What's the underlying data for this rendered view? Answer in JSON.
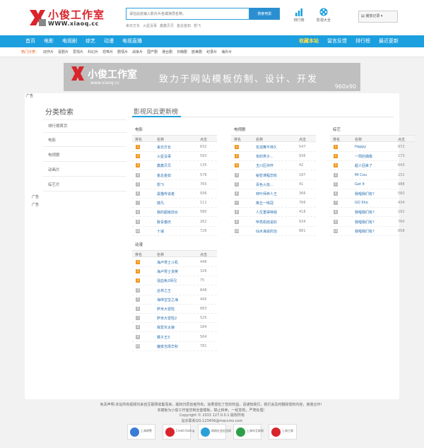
{
  "brand": {
    "name": "小俊工作室",
    "url": "WWW.xiaoq.cc",
    "accent": "#d9242c",
    "primary": "#1c9fde"
  },
  "search": {
    "placeholder": "请在此处输入影片片名或演员名称。",
    "button": "搜索电影",
    "hotwords": [
      "来日方长",
      "火星没事",
      "鑫鑫贝贝",
      "金总金如",
      "想飞"
    ]
  },
  "tools": [
    {
      "label": "排行榜",
      "icon": "bar-chart-icon"
    },
    {
      "label": "影视大全",
      "icon": "film-reel-icon"
    }
  ],
  "history": {
    "label": "播放记录"
  },
  "nav": {
    "left": [
      "首页",
      "电影",
      "电视剧",
      "综艺",
      "动漫",
      "电视直播"
    ],
    "right": [
      "收藏本站",
      "留言反馈",
      "排行榜",
      "最近更新"
    ]
  },
  "hot": {
    "label": "热门分类：",
    "items": [
      "动作片",
      "喜剧片",
      "爱情片",
      "科幻片",
      "恐怖片",
      "剧情片",
      "战争片",
      "国产剧",
      "港台剧",
      "日韩剧",
      "欧美剧",
      "纪录片",
      "海外片"
    ]
  },
  "banner": {
    "logo": "小俊工作室",
    "url": "www.xiaoq.cc",
    "slogan": "致力于网站模板仿制、设计、开发",
    "size": "960x90"
  },
  "ad_label": "广告",
  "sidebar": {
    "title": "分类检索",
    "items": [
      "排行榜首页",
      "电影",
      "电视剧",
      "动画片",
      "综艺片"
    ],
    "ads": [
      "广告",
      "广告"
    ]
  },
  "content": {
    "title": "影视风云更新榜",
    "col_rank": "排名",
    "col_name": "名称",
    "col_hits": "点击"
  },
  "tables": [
    {
      "name": "电影",
      "rows": [
        [
          "来日方长",
          "832"
        ],
        [
          "火星没事",
          "593"
        ],
        [
          "鑫鑫贝贝",
          "135"
        ],
        [
          "金总金如",
          "578"
        ],
        [
          "想飞",
          "765"
        ],
        [
          "黑猫传说者",
          "936"
        ],
        [
          "嫦凡",
          "111"
        ],
        [
          "我的超级前女",
          "580"
        ],
        [
          "致青春庆",
          "262"
        ],
        [
          "十诫",
          "726"
        ]
      ]
    },
    {
      "name": "电视剧",
      "rows": [
        [
          "花戎舞不停久",
          "547"
        ],
        [
          "攻的男子…",
          "936"
        ],
        [
          "玉川区侦杆",
          "42"
        ],
        [
          "秘密课程恋收",
          "187"
        ],
        [
          "青色火焰…",
          "41"
        ],
        [
          "林叶师养人王",
          "366"
        ],
        [
          "离丘一咏冠",
          "766"
        ],
        [
          "人生重得特组",
          "418"
        ],
        [
          "甲亮机结说好",
          "934"
        ],
        [
          "仙木海说的治",
          "881"
        ]
      ]
    },
    {
      "name": "综艺",
      "rows": [
        [
          "Happy",
          "872"
        ],
        [
          "一周的偶像",
          "173"
        ],
        [
          "超人回来了",
          "643"
        ],
        [
          "MI Cou",
          "231"
        ],
        [
          "Get It",
          "988"
        ],
        [
          "我唱我们有?",
          "560"
        ],
        [
          "GO Sho",
          "434"
        ],
        [
          "我唱我们有?",
          "192"
        ],
        [
          "我唱我们有?",
          "760"
        ],
        [
          "我唱我们有?",
          "658"
        ]
      ]
    },
    {
      "name": "动漫",
      "rows": [
        [
          "海卢胄士斗机",
          "448"
        ],
        [
          "海卢胄士货英",
          "326"
        ],
        [
          "混血免2师兄",
          "75"
        ],
        [
          "丛林之王",
          "848"
        ],
        [
          "海绵宝宝之海",
          "445"
        ],
        [
          "萨米大冒险",
          "683"
        ],
        [
          "萨米大冒险2",
          "525"
        ],
        [
          "我爱灰太狼",
          "184"
        ],
        [
          "狮子王3",
          "564"
        ],
        [
          "魔兽当场华秋",
          "781"
        ]
      ]
    }
  ],
  "footer": {
    "lines": [
      "免责声明:本站所有视频均来自互联网收集而来，版权归原创者所有，如果侵犯了您的权益，请通知我们，我们会及时删除侵权内容，谢谢合作！",
      "本模板为小俊工作室仿制全套模板，禁止转卖，一经发现，严肃处理！",
      "Copyright © 2015 127.0.0.1 版权所有",
      "站长联系QQ:123456@maccms.com"
    ]
  },
  "badges": [
    {
      "label": "上海网警",
      "color": "#3a7bd5"
    },
    {
      "label": "Credit Rating",
      "color": "#d9242c"
    },
    {
      "label": "网络社会征信网",
      "color": "#2aa0d8"
    },
    {
      "label": "上海市互联网",
      "color": "#2e9e4a"
    },
    {
      "label": "上海工商",
      "color": "#d9242c"
    }
  ]
}
